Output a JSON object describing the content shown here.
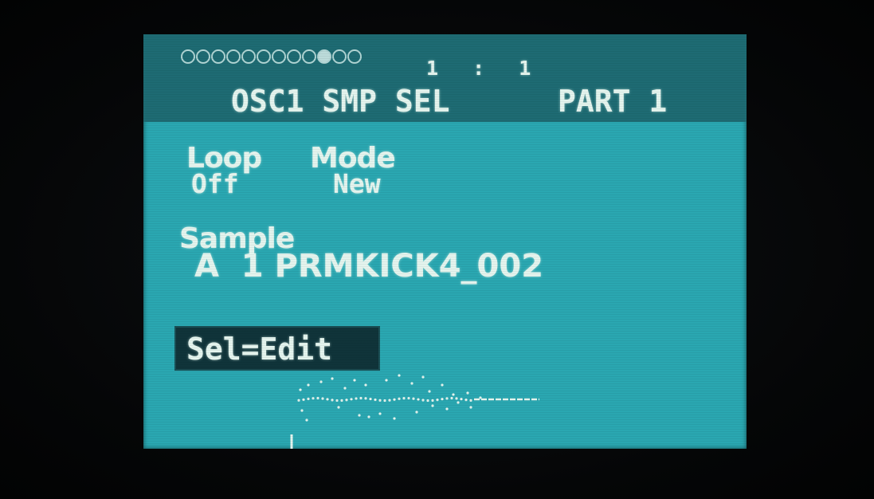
{
  "header": {
    "page_indicator": {
      "total": 12,
      "active_index": 9
    },
    "position": "1 : 1",
    "title": "OSC1 SMP SEL",
    "part": "PART 1"
  },
  "params": {
    "loop": {
      "label": "Loop",
      "value": "Off"
    },
    "mode": {
      "label": "Mode",
      "value": "New"
    }
  },
  "sample": {
    "label": "Sample",
    "value": "A  1 PRMKICK4_002"
  },
  "edit_button": {
    "label": "Sel=Edit"
  },
  "colors": {
    "screen_bg": "#2aa7b1",
    "header_bg": "#1e6b73",
    "text": "#e4f4ee",
    "highlight_bg": "#10343a"
  }
}
